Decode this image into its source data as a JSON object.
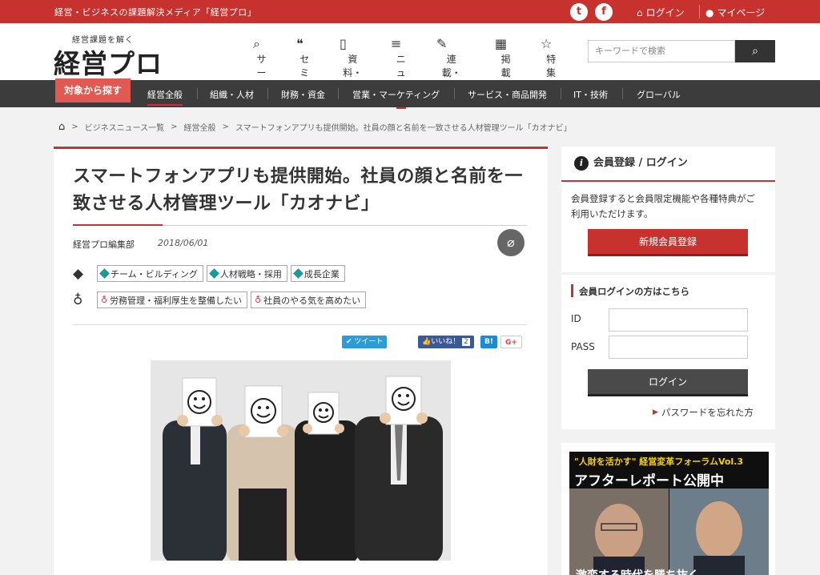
{
  "topbar": {
    "tagline": "経営・ビジネスの課題解決メディア「経営プロ」",
    "twitter_glyph": "t",
    "facebook_glyph": "f",
    "login": "ログイン",
    "mypage": "マイページ"
  },
  "logo": {
    "sub": "経営課題を解く",
    "main": "経営プロ"
  },
  "nav": [
    {
      "label": "サービス",
      "icon": "🔍"
    },
    {
      "label": "セミナー",
      "icon": "💬"
    },
    {
      "label": "資料・事例",
      "icon": "📄"
    },
    {
      "label": "ニュース",
      "icon": "☰"
    },
    {
      "label": "連載・コラム",
      "icon": "✎"
    },
    {
      "label": "掲載企業",
      "icon": "▦"
    },
    {
      "label": "特集",
      "icon": "☆"
    }
  ],
  "search": {
    "placeholder": "キーワードで検索",
    "button": "🔍"
  },
  "categories": {
    "find": "対象から探す",
    "items": [
      "経営全般",
      "組織・人材",
      "財務・資金",
      "営業・マーケティング",
      "サービス・商品開発",
      "IT・技術",
      "グローバル"
    ]
  },
  "breadcrumb": {
    "items": [
      "ビジネスニュース一覧",
      "経営全般",
      "スマートフォンアプリも提供開始。社員の顔と名前を一致させる人材管理ツール「カオナビ」"
    ]
  },
  "article": {
    "title": "スマートフォンアプリも提供開始。社員の顔と名前を一致させる人材管理ツール「カオナビ」",
    "author": "経営プロ編集部",
    "date": "2018/06/01",
    "tags": [
      "チーム・ビルディング",
      "人材戦略・採用",
      "成長企業"
    ],
    "themes": [
      "労務管理・福利厚生を整備したい",
      "社員のやる気を高めたい"
    ],
    "share": {
      "tweet": "ツイート",
      "like": "いいね！",
      "like_count": "2",
      "hatena": "B!",
      "gplus": "G+"
    }
  },
  "sidebar": {
    "member_title": "会員登録 / ログイン",
    "member_text": "会員登録すると会員限定機能や各種特典がご利用いただけます。",
    "register_button": "新規会員登録",
    "login_title": "会員ログインの方はこちら",
    "id_label": "ID",
    "pass_label": "PASS",
    "login_button": "ログイン",
    "forgot": "パスワードを忘れた方"
  },
  "banner": {
    "line1": "\"人財を活かす\" 経営変革フォーラムVol.3",
    "line2": "アフターレポート公開中",
    "line3": "激変する時代を勝ち抜く"
  }
}
